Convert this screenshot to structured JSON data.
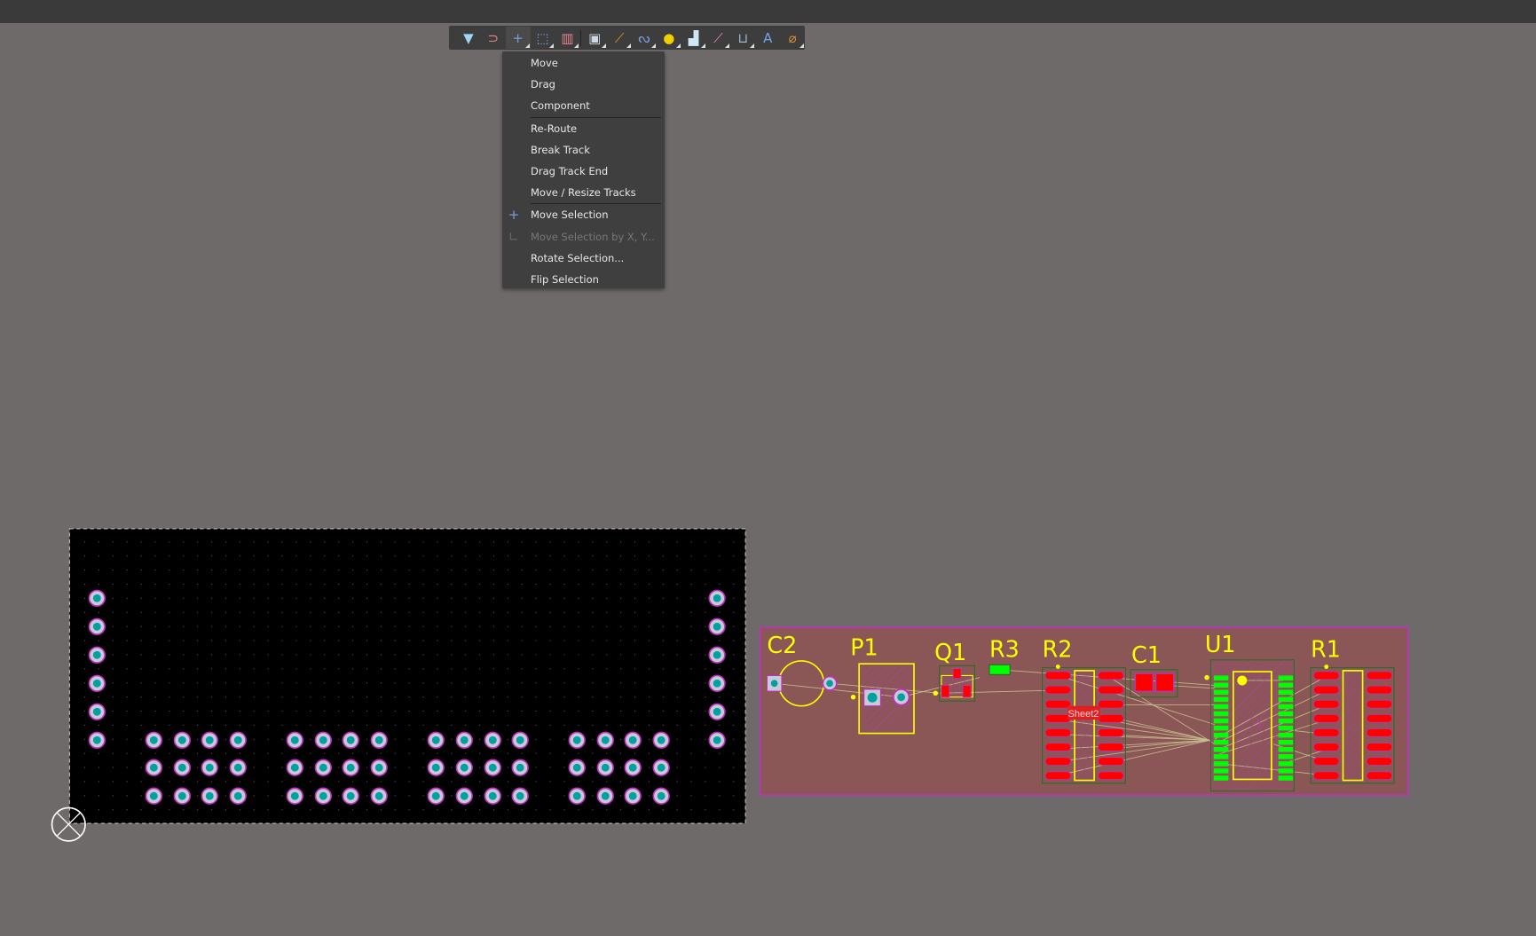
{
  "toolbar": {
    "items": [
      {
        "icon": "filter-icon",
        "glyph": "▼",
        "color": "#9fd6f5"
      },
      {
        "icon": "snap-magnet-icon",
        "glyph": "⊃",
        "color": "#e8828f"
      },
      {
        "icon": "move-cross-icon",
        "glyph": "+",
        "color": "#7a9ee0",
        "active": true,
        "dropdown": true
      },
      {
        "icon": "select-rect-icon",
        "glyph": "⬚",
        "color": "#7a9ee0",
        "dropdown": true
      },
      {
        "icon": "align-icon",
        "glyph": "▥",
        "color": "#e8828f",
        "dropdown": true
      },
      {
        "icon": "component-icon",
        "glyph": "▣",
        "color": "#cfd8e0",
        "dropdown": true,
        "sep_before": true
      },
      {
        "icon": "route-track-icon",
        "glyph": "⟋",
        "color": "#e0a020",
        "dropdown": true
      },
      {
        "icon": "tune-length-icon",
        "glyph": "ᔓ",
        "color": "#7a9ee0",
        "dropdown": true
      },
      {
        "icon": "via-icon",
        "glyph": "●",
        "color": "#f0d000",
        "dropdown": true
      },
      {
        "icon": "polygon-icon",
        "glyph": "▟",
        "color": "#cfe6f5",
        "dropdown": true
      },
      {
        "icon": "track-icon",
        "glyph": "⟋",
        "color": "#ea88c8",
        "dropdown": true
      },
      {
        "icon": "dimension-icon",
        "glyph": "⊔",
        "color": "#9fb6d0",
        "dropdown": true
      },
      {
        "icon": "text-icon",
        "glyph": "A",
        "color": "#6ea6e8"
      },
      {
        "icon": "arc-icon",
        "glyph": "⌀",
        "color": "#e09030",
        "dropdown": true
      }
    ]
  },
  "menu": {
    "items": [
      {
        "label": "Move"
      },
      {
        "label": "Drag"
      },
      {
        "label": "Component",
        "sep_after": true
      },
      {
        "label": "Re-Route"
      },
      {
        "label": "Break Track"
      },
      {
        "label": "Drag Track End"
      },
      {
        "label": "Move / Resize Tracks",
        "sep_after": true
      },
      {
        "label": "Move Selection",
        "icon": "move-cross-icon",
        "glyph": "+"
      },
      {
        "label": "Move Selection by X, Y...",
        "icon": "move-xy-icon",
        "glyph": "∟",
        "disabled": true
      },
      {
        "label": "Rotate Selection..."
      },
      {
        "label": "Flip Selection"
      }
    ]
  },
  "pcb": {
    "designators": [
      "C2",
      "P1",
      "Q1",
      "R3",
      "R2",
      "C1",
      "U1",
      "R1"
    ],
    "sheet_label": "Sheet2",
    "u1_marker": "1"
  },
  "colors": {
    "board_black": "#000000",
    "board_red": "#8b5656",
    "silk": "#ffff00",
    "pad_smd": "#ff0000",
    "pad_top": "#00ff00",
    "pad_hole": "#00a0a0",
    "keepout": "#c030c0"
  }
}
